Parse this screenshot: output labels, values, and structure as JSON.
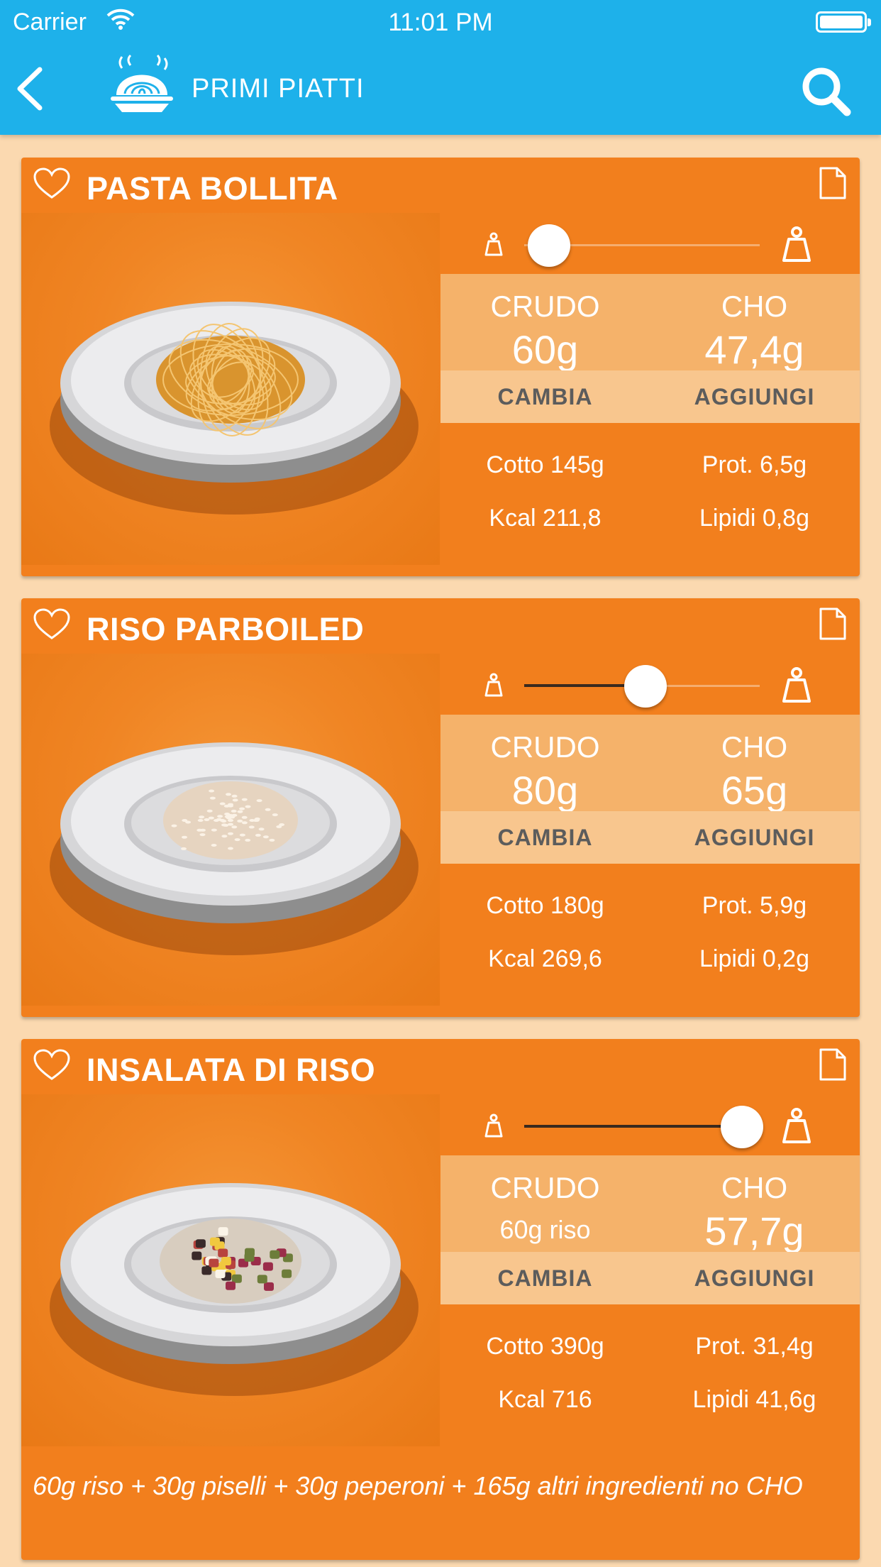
{
  "status_bar": {
    "carrier": "Carrier",
    "time": "11:01 PM"
  },
  "navbar": {
    "title": "PRIMI PIATTI",
    "back_icon": "chevron-left-icon",
    "logo_icon": "pasta-plate-icon",
    "search_icon": "search-icon"
  },
  "colors": {
    "topbar": "#1eb1ea",
    "background": "#fbd9b0",
    "card": "#f27f1d",
    "values_band": "#f5b26a",
    "actions_band": "#f8c68e"
  },
  "cards": [
    {
      "title": "PASTA BOLLITA",
      "slider_level": 0,
      "crudo_label": "CRUDO",
      "crudo_value": "60g",
      "cho_label": "CHO",
      "cho_value": "47,4g",
      "cambia": "CAMBIA",
      "aggiungi": "AGGIUNGI",
      "cotto": "Cotto 145g",
      "prot": "Prot. 6,5g",
      "kcal": "Kcal 211,8",
      "lipidi": "Lipidi 0,8g",
      "food": "spaghetti"
    },
    {
      "title": "RISO PARBOILED",
      "slider_level": 0.5,
      "crudo_label": "CRUDO",
      "crudo_value": "80g",
      "cho_label": "CHO",
      "cho_value": "65g",
      "cambia": "CAMBIA",
      "aggiungi": "AGGIUNGI",
      "cotto": "Cotto 180g",
      "prot": "Prot. 5,9g",
      "kcal": "Kcal 269,6",
      "lipidi": "Lipidi 0,2g",
      "food": "rice"
    },
    {
      "title": "INSALATA DI RISO",
      "slider_level": 1,
      "crudo_label": "CRUDO",
      "crudo_value": "60g riso",
      "cho_label": "CHO",
      "cho_value": "57,7g",
      "cambia": "CAMBIA",
      "aggiungi": "AGGIUNGI",
      "cotto": "Cotto 390g",
      "prot": "Prot. 31,4g",
      "kcal": "Kcal 716",
      "lipidi": "Lipidi 41,6g",
      "food": "rice-salad",
      "note": "60g riso + 30g piselli + 30g peperoni + 165g altri ingredienti no CHO"
    }
  ]
}
